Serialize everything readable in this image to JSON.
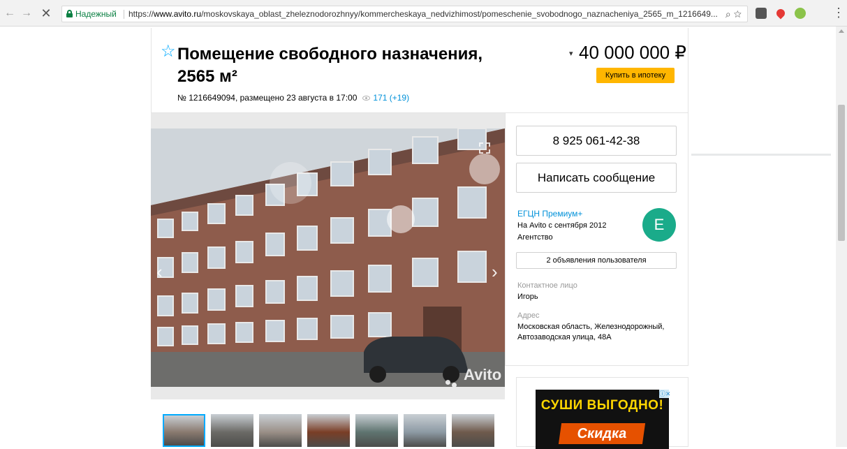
{
  "browser": {
    "secure_label": "Надежный",
    "url_scheme": "https://",
    "url_host": "www.avito.ru",
    "url_path": "/moskovskaya_oblast_zheleznodorozhnyy/kommercheskaya_nedvizhimost/pomeschenie_svobodnogo_naznacheniya_2565_m_1216649...",
    "back_icon": "←",
    "forward_icon": "→",
    "stop_icon": "✕",
    "zoom_icon": "⌕",
    "bookmark_icon": "☆",
    "menu_icon": "⋮"
  },
  "listing": {
    "title": "Помещение свободного назначения, 2565 м²",
    "meta": "№ 1216649094, размещено 23 августа в 17:00",
    "views": "171 (+19)",
    "price": "40 000 000 ₽",
    "price_chevron": "▾",
    "mortgage_button": "Купить в ипотеку"
  },
  "gallery": {
    "prev": "‹",
    "next": "›",
    "watermark": "Avito",
    "thumbnails": [
      {
        "color": "#8a7a70"
      },
      {
        "color": "#6b6a66"
      },
      {
        "color": "#9a8f87"
      },
      {
        "color": "#7a3e26"
      },
      {
        "color": "#5f7470"
      },
      {
        "color": "#8d9aa4"
      },
      {
        "color": "#6f5a4c"
      }
    ]
  },
  "contact": {
    "phone": "8 925 061-42-38",
    "message_button": "Написать сообщение",
    "seller_name": "ЕГЦН Премиум+",
    "seller_since": "На Avito с сентября 2012",
    "seller_type": "Агентство",
    "avatar_letter": "E",
    "ads_button": "2 объявления пользователя",
    "contact_label": "Контактное лицо",
    "contact_value": "Игорь",
    "address_label": "Адрес",
    "address_value": "Московская область, Железнодорожный, Автозаводская улица, 48А"
  },
  "ad": {
    "line1": "СУШИ ВЫГОДНО!",
    "line2": "Скидка",
    "close": "ⓘ✕"
  },
  "colors": {
    "accent_blue": "#00aaff",
    "link_blue": "#0091d9",
    "mortgage_yellow": "#ffb600",
    "avatar_green": "#1aab8a"
  }
}
